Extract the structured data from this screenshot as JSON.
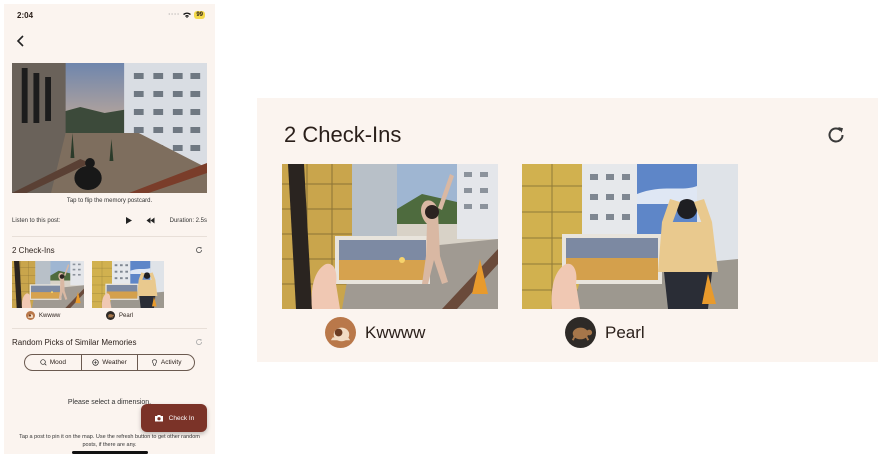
{
  "status_bar": {
    "time": "2:04",
    "battery": "99"
  },
  "postcard": {
    "caption": "Tap to flip the memory postcard."
  },
  "audio": {
    "listen_label": "Listen to this post:",
    "duration": "Duration: 2.5s"
  },
  "checkins": {
    "title": "2 Check-Ins",
    "users": [
      {
        "name": "Kwwww",
        "avatar": "snail-avatar-icon"
      },
      {
        "name": "Pearl",
        "avatar": "turtle-avatar-icon"
      }
    ]
  },
  "similar": {
    "title": "Random Picks of Similar Memories",
    "filters": [
      {
        "label": "Mood",
        "icon": "mood-icon"
      },
      {
        "label": "Weather",
        "icon": "weather-icon"
      },
      {
        "label": "Activity",
        "icon": "activity-icon"
      }
    ],
    "empty_message": "Please select a dimension."
  },
  "checkin_button": {
    "label": "Check In"
  },
  "hint": "Tap a post to pin it on the map. Use the refresh button to get other random posts, if there are any.",
  "colors": {
    "background": "#fbf4ef",
    "accent": "#7b3328",
    "text": "#2a1f1a"
  }
}
